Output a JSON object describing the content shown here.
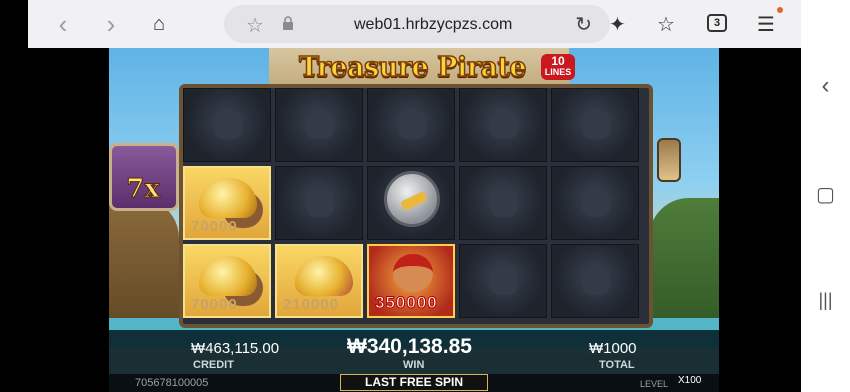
{
  "browser": {
    "url": "web01.hrbzycpzs.com",
    "tab_count": "3",
    "back_icon": "back-arrow-icon",
    "forward_icon": "forward-arrow-icon"
  },
  "game": {
    "title": "Treasure Pirate",
    "lines_badge_number": "10",
    "lines_badge_text": "LINES",
    "multiplier": "7x",
    "cells": {
      "r2c1": "70000",
      "r3c1": "70000",
      "r3c2": "210000",
      "r3c3": "350000"
    },
    "credit_value": "₩463,115.00",
    "credit_label": "CREDIT",
    "win_value": "₩340,138.85",
    "win_label": "WIN",
    "total_value": "₩1000",
    "total_label": "TOTAL",
    "session_id": "705678100005",
    "free_spin_label": "LAST FREE SPIN",
    "level_label": "LEVEL",
    "level_value": "X100"
  },
  "colors": {
    "title_gold": "#ffd23a",
    "badge_red": "#c9181e",
    "win_highlight": "#b60000"
  }
}
